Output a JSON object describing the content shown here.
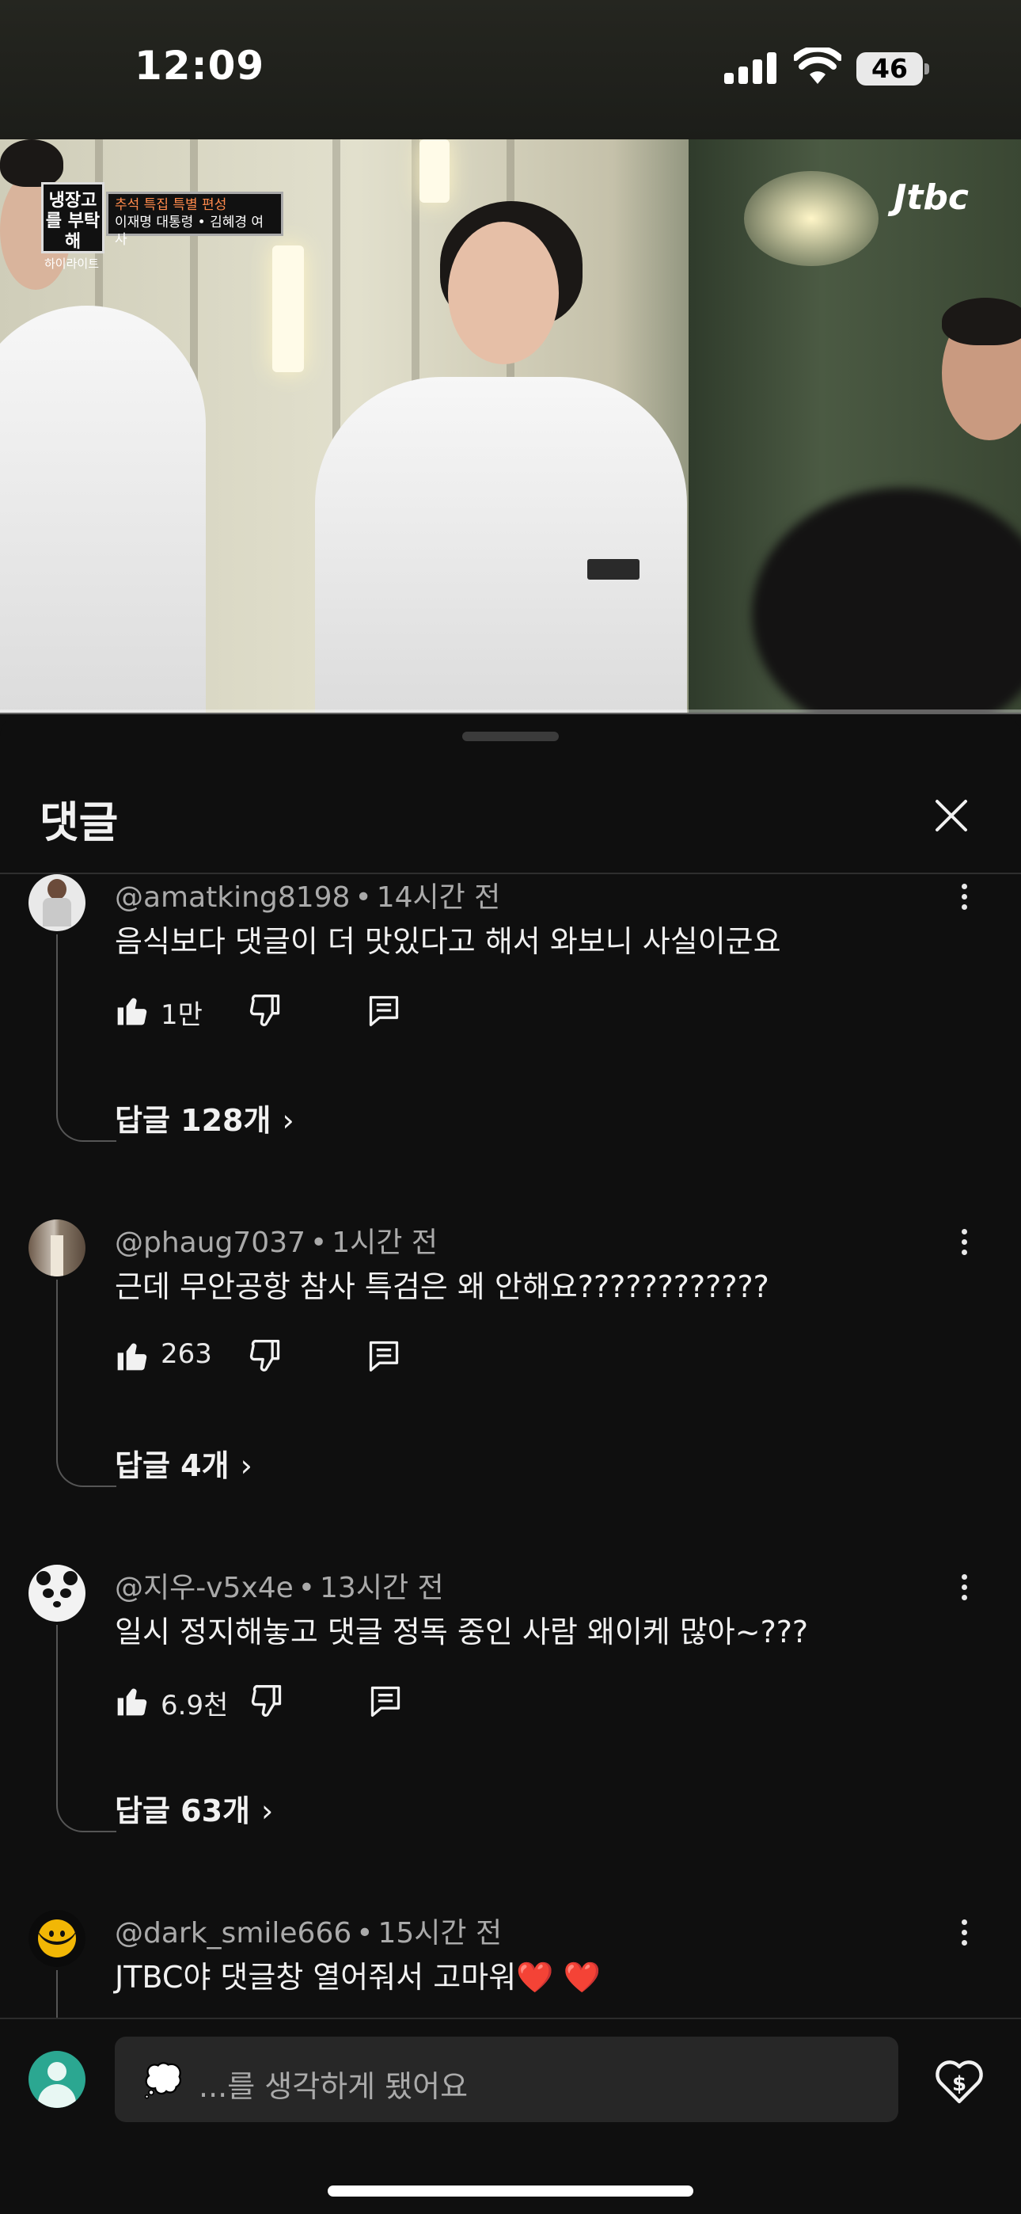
{
  "status_bar": {
    "time": "12:09",
    "battery": "46"
  },
  "video": {
    "show_logo": "냉장고를 부탁해",
    "show_logo_sub": "하이라이트",
    "banner_line1": "추석 특집 특별 편성",
    "banner_line2": "이재명 대통령 • 김혜경 여사",
    "channel_logo": "Jtbc"
  },
  "sheet": {
    "title": "댓글"
  },
  "comments": [
    {
      "author": "@amatking8198",
      "time": "14시간 전",
      "text": "음식보다 댓글이 더 맛있다고 해서 와보니 사실이군요",
      "likes": "1만",
      "replies": "답글 128개"
    },
    {
      "author": "@phaug7037",
      "time": "1시간 전",
      "text": "근데 무안공항 참사 특검은 왜 안해요????????????",
      "likes": "263",
      "replies": "답글 4개"
    },
    {
      "author": "@지우-v5x4e",
      "time": "13시간 전",
      "text": "일시 정지해놓고 댓글 정독 중인 사람 왜이케 많아~???",
      "likes": "6.9천",
      "replies": "답글 63개"
    },
    {
      "author": "@dark_smile666",
      "time": "15시간 전",
      "text": "JTBC야 댓글창 열어줘서 고마워❤️ ❤️",
      "likes": "",
      "replies": ""
    }
  ],
  "composer": {
    "emoji": "💭",
    "placeholder": "...를 생각하게 됐어요"
  },
  "icons": {
    "like": "thumbs-up-icon",
    "dislike": "thumbs-down-icon",
    "reply": "reply-icon",
    "more": "more-vert-icon",
    "close": "close-icon",
    "thanks": "super-thanks-icon"
  },
  "colors": {
    "background": "#0f0f0f",
    "text": "#f1f1f1",
    "secondary_text": "#aaaaaa",
    "input_bg": "#272727"
  }
}
